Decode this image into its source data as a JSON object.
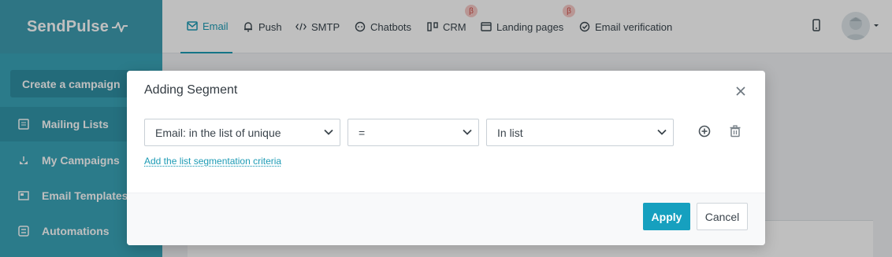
{
  "brand": {
    "name": "SendPulse"
  },
  "sidebar": {
    "create_button": "Create a campaign",
    "items": [
      {
        "label": "Mailing Lists",
        "icon": "mailing-list-icon"
      },
      {
        "label": "My Campaigns",
        "icon": "campaigns-icon"
      },
      {
        "label": "Email Templates",
        "icon": "templates-icon"
      },
      {
        "label": "Automations",
        "icon": "automations-icon"
      }
    ]
  },
  "topnav": {
    "items": [
      {
        "label": "Email",
        "icon": "envelope-icon",
        "active": true
      },
      {
        "label": "Push",
        "icon": "bell-icon"
      },
      {
        "label": "SMTP",
        "icon": "code-icon"
      },
      {
        "label": "Chatbots",
        "icon": "chat-icon"
      },
      {
        "label": "CRM",
        "icon": "crm-icon",
        "beta": true
      },
      {
        "label": "Landing pages",
        "icon": "landing-icon",
        "beta": true
      },
      {
        "label": "Email verification",
        "icon": "check-circle-icon"
      }
    ],
    "beta_label": "β"
  },
  "modal": {
    "title": "Adding Segment",
    "condition": {
      "field": "Email: in the list of unique",
      "operator": "=",
      "value": "In list"
    },
    "criteria_link": "Add the list segmentation criteria",
    "apply_label": "Apply",
    "cancel_label": "Cancel"
  },
  "colors": {
    "sidebar": "#3aa4b8",
    "accent": "#1d9bb5",
    "apply_button": "#16a0bf",
    "beta_badge": "#f6c9c6"
  }
}
